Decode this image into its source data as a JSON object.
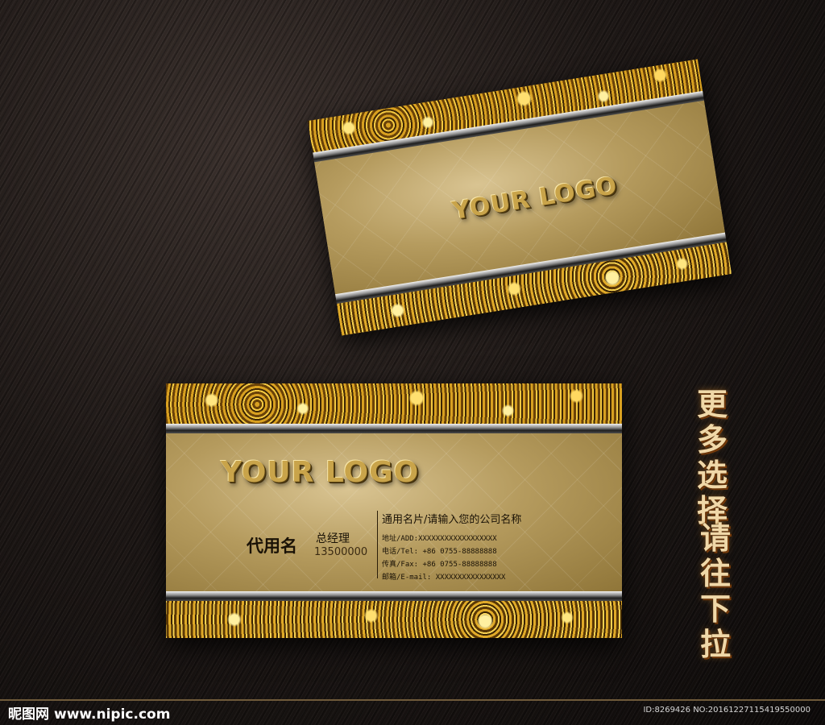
{
  "card_back": {
    "logo": "YOUR LOGO"
  },
  "card_front": {
    "logo": "YOUR LOGO",
    "name": "代用名",
    "title": "总经理",
    "phone": "13500000",
    "company": "通用名片/请输入您的公司名称",
    "info_lines": [
      "地址/ADD:XXXXXXXXXXXXXXXXXX",
      "电话/Tel: +86 0755-88888888",
      "传真/Fax: +86 0755-88888888",
      "邮箱/E-mail: XXXXXXXXXXXXXXXX"
    ]
  },
  "side_text": {
    "col1": [
      "更",
      "多",
      "选",
      "择"
    ],
    "col2": [
      "请",
      "往",
      "下",
      "拉"
    ]
  },
  "footer": {
    "brand": "昵图网",
    "url": "www.nipic.com",
    "image_id": "ID:8269426 NO:20161227115419550000"
  }
}
